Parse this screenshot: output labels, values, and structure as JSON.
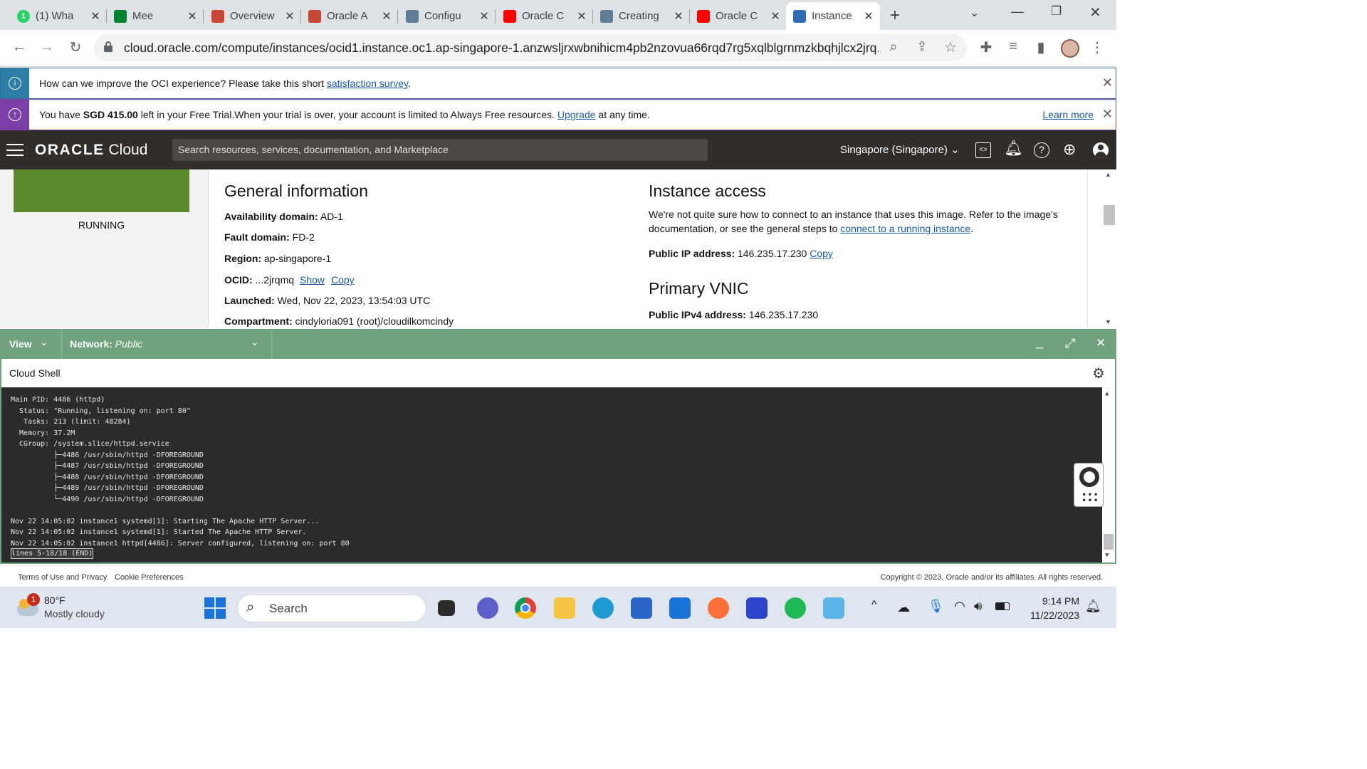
{
  "browser": {
    "tabs": [
      {
        "title": "(1) Wha",
        "color": "#25d366",
        "badge": "1"
      },
      {
        "title": "Mee",
        "color": "#00832d"
      },
      {
        "title": "Overview",
        "color": "#c74634"
      },
      {
        "title": "Oracle A",
        "color": "#c74634"
      },
      {
        "title": "Configu",
        "color": "#5f7e96"
      },
      {
        "title": "Oracle C",
        "color": "#ff0000"
      },
      {
        "title": "Creating",
        "color": "#5f7e96"
      },
      {
        "title": "Oracle C",
        "color": "#ff0000"
      },
      {
        "title": "Instance",
        "color": "#2f6db5"
      }
    ],
    "url": "cloud.oracle.com/compute/instances/ocid1.instance.oc1.ap-singapore-1.anzwsljrxwbnihicm4pb2nzovua66rqd7rg5xqlblgrnmzkbqhjlcx2jrq..."
  },
  "banners": {
    "survey_text": "How can we improve the OCI experience? Please take this short ",
    "survey_link": "satisfaction survey",
    "survey_end": ".",
    "trial_pre": "You have ",
    "trial_amount": "SGD 415.00",
    "trial_mid": " left in your Free Trial.When your trial is over, your account is limited to Always Free resources. ",
    "trial_link": "Upgrade",
    "trial_end": " at any time.",
    "learn_more": "Learn more"
  },
  "header": {
    "logo_brand": "ORACLE",
    "logo_product": "Cloud",
    "search_placeholder": "Search resources, services, documentation, and Marketplace",
    "region": "Singapore (Singapore)"
  },
  "instance": {
    "state": "RUNNING",
    "general_title": "General information",
    "general": [
      {
        "k": "Availability domain:",
        "v": " AD-1"
      },
      {
        "k": "Fault domain:",
        "v": " FD-2"
      },
      {
        "k": "Region:",
        "v": " ap-singapore-1"
      },
      {
        "k": "OCID:",
        "v": " ...2jrqmq"
      },
      {
        "k": "Launched:",
        "v": " Wed, Nov 22, 2023, 13:54:03 UTC"
      },
      {
        "k": "Compartment:",
        "v": " cindyloria091 (root)/cloudilkomcindy"
      }
    ],
    "ocid_show": "Show",
    "ocid_copy": "Copy",
    "access_title": "Instance access",
    "access_text1": "We're not quite sure how to connect to an instance that uses this image. Refer to the image's",
    "access_text2": "documentation, or see the general steps to ",
    "access_link": "connect to a running instance",
    "access_end": ".",
    "public_ip_label": "Public IP address:",
    "public_ip": " 146.235.17.230 ",
    "copy": "Copy",
    "vnic_title": "Primary VNIC",
    "ipv4_label": "Public IPv4 address:",
    "ipv4": " 146.235.17.230"
  },
  "cloudshell": {
    "view": "View",
    "network_label": "Network:",
    "network_value": "Public",
    "title": "Cloud Shell",
    "lines": [
      "Main PID: 4486 (httpd)",
      "  Status: \"Running, listening on: port 80\"",
      "   Tasks: 213 (limit: 48284)",
      "  Memory: 37.2M",
      "  CGroup: /system.slice/httpd.service",
      "          ├─4486 /usr/sbin/httpd -DFOREGROUND",
      "          ├─4487 /usr/sbin/httpd -DFOREGROUND",
      "          ├─4488 /usr/sbin/httpd -DFOREGROUND",
      "          ├─4489 /usr/sbin/httpd -DFOREGROUND",
      "          └─4490 /usr/sbin/httpd -DFOREGROUND",
      "",
      "Nov 22 14:05:02 instance1 systemd[1]: Starting The Apache HTTP Server...",
      "Nov 22 14:05:02 instance1 systemd[1]: Started The Apache HTTP Server.",
      "Nov 22 14:05:02 instance1 httpd[4486]: Server configured, listening on: port 80"
    ],
    "status_line": "lines 5-18/18 (END)"
  },
  "footer": {
    "terms": "Terms of Use and Privacy",
    "cookies": "Cookie Preferences",
    "copyright": "Copyright © 2023, Oracle and/or its affiliates. All rights reserved."
  },
  "taskbar": {
    "weather_temp": "80°F",
    "weather_desc": "Mostly cloudy",
    "weather_badge": "1",
    "search": "Search",
    "time": "9:14 PM",
    "date": "11/22/2023"
  },
  "colors": {
    "oci_header": "#312d2a",
    "cloudshell_bar": "#6fa27d",
    "running_green": "#5e8a2e",
    "link": "#1a5ba6"
  }
}
